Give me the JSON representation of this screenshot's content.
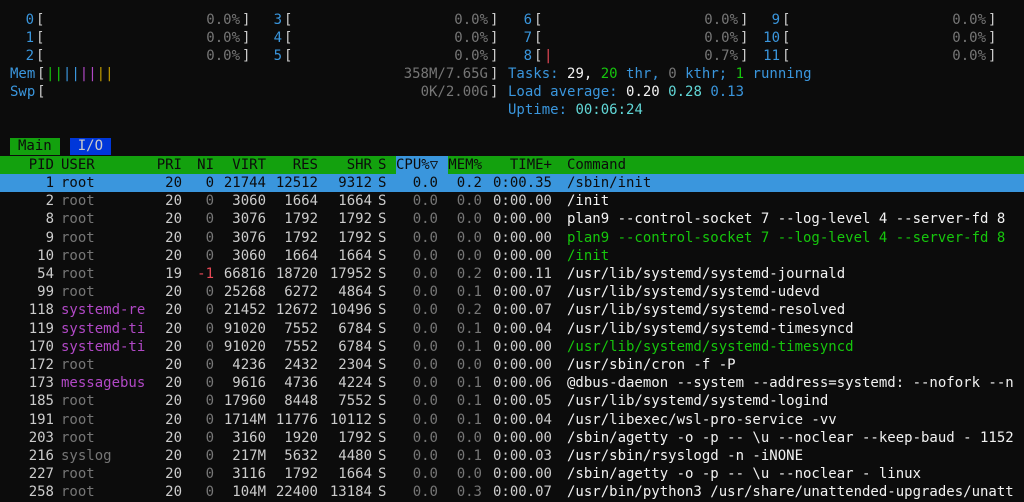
{
  "cpus": [
    {
      "id": "0",
      "bar": "",
      "value": "0.0%"
    },
    {
      "id": "1",
      "bar": "",
      "value": "0.0%"
    },
    {
      "id": "2",
      "bar": "",
      "value": "0.0%"
    },
    {
      "id": "3",
      "bar": "",
      "value": "0.0%"
    },
    {
      "id": "4",
      "bar": "",
      "value": "0.0%"
    },
    {
      "id": "5",
      "bar": "",
      "value": "0.0%"
    },
    {
      "id": "6",
      "bar": "",
      "value": "0.0%"
    },
    {
      "id": "7",
      "bar": "",
      "value": "0.0%"
    },
    {
      "id": "8",
      "bar": "|",
      "value": "0.7%"
    },
    {
      "id": "9",
      "bar": "",
      "value": "0.0%"
    },
    {
      "id": "10",
      "bar": "",
      "value": "0.0%"
    },
    {
      "id": "11",
      "bar": "",
      "value": "0.0%"
    }
  ],
  "mem": {
    "label": "Mem",
    "bars": "||||||||",
    "value": "358M/7.65G"
  },
  "swp": {
    "label": "Swp",
    "bars": "",
    "value": "0K/2.00G"
  },
  "tasks": {
    "label": "Tasks:",
    "count": "29,",
    "thr": "20",
    "thr_label": "thr,",
    "kthr": "0",
    "kthr_label": "kthr;",
    "running": "1",
    "running_label": "running"
  },
  "load": {
    "label": "Load average:",
    "v1": "0.20",
    "v5": "0.28",
    "v15": "0.13"
  },
  "uptime": {
    "label": "Uptime:",
    "value": "00:06:24"
  },
  "tabs": [
    "Main",
    "I/O"
  ],
  "columns": {
    "pid": "PID",
    "user": "USER",
    "pri": "PRI",
    "ni": "NI",
    "virt": "VIRT",
    "res": "RES",
    "shr": "SHR",
    "s": "S",
    "cpu": "CPU%▽",
    "mem": "MEM%",
    "time": "TIME+",
    "command": "Command"
  },
  "processes": [
    {
      "pid": "1",
      "user": "root",
      "pri": "20",
      "ni": "0",
      "virt": "21744",
      "res": "12512",
      "shr": "9312",
      "s": "S",
      "cpu": "0.0",
      "mem": "0.2",
      "time": "0:00.35",
      "command": "/sbin/init",
      "ucolor": "w",
      "ccolor": "w",
      "selected": true
    },
    {
      "pid": "2",
      "user": "root",
      "pri": "20",
      "ni": "0",
      "virt": "3060",
      "res": "1664",
      "shr": "1664",
      "s": "S",
      "cpu": "0.0",
      "mem": "0.0",
      "time": "0:00.00",
      "command": "/init",
      "ucolor": "gray",
      "ccolor": "w"
    },
    {
      "pid": "8",
      "user": "root",
      "pri": "20",
      "ni": "0",
      "virt": "3076",
      "res": "1792",
      "shr": "1792",
      "s": "S",
      "cpu": "0.0",
      "mem": "0.0",
      "time": "0:00.00",
      "command": "plan9 --control-socket 7 --log-level 4 --server-fd 8",
      "ucolor": "gray",
      "ccolor": "w"
    },
    {
      "pid": "9",
      "user": "root",
      "pri": "20",
      "ni": "0",
      "virt": "3076",
      "res": "1792",
      "shr": "1792",
      "s": "S",
      "cpu": "0.0",
      "mem": "0.0",
      "time": "0:00.00",
      "command": "plan9 --control-socket 7 --log-level 4 --server-fd 8",
      "ucolor": "gray",
      "ccolor": "g"
    },
    {
      "pid": "10",
      "user": "root",
      "pri": "20",
      "ni": "0",
      "virt": "3060",
      "res": "1664",
      "shr": "1664",
      "s": "S",
      "cpu": "0.0",
      "mem": "0.0",
      "time": "0:00.00",
      "command": "/init",
      "ucolor": "gray",
      "ccolor": "g"
    },
    {
      "pid": "54",
      "user": "root",
      "pri": "19",
      "ni": "-1",
      "virt": "66816",
      "res": "18720",
      "shr": "17952",
      "s": "S",
      "cpu": "0.0",
      "mem": "0.2",
      "time": "0:00.11",
      "command": "/usr/lib/systemd/systemd-journald",
      "ucolor": "gray",
      "ccolor": "w"
    },
    {
      "pid": "99",
      "user": "root",
      "pri": "20",
      "ni": "0",
      "virt": "25268",
      "res": "6272",
      "shr": "4864",
      "s": "S",
      "cpu": "0.0",
      "mem": "0.1",
      "time": "0:00.07",
      "command": "/usr/lib/systemd/systemd-udevd",
      "ucolor": "gray",
      "ccolor": "w"
    },
    {
      "pid": "118",
      "user": "systemd-re",
      "pri": "20",
      "ni": "0",
      "virt": "21452",
      "res": "12672",
      "shr": "10496",
      "s": "S",
      "cpu": "0.0",
      "mem": "0.2",
      "time": "0:00.07",
      "command": "/usr/lib/systemd/systemd-resolved",
      "ucolor": "mag",
      "ccolor": "w"
    },
    {
      "pid": "119",
      "user": "systemd-ti",
      "pri": "20",
      "ni": "0",
      "virt": "91020",
      "res": "7552",
      "shr": "6784",
      "s": "S",
      "cpu": "0.0",
      "mem": "0.1",
      "time": "0:00.04",
      "command": "/usr/lib/systemd/systemd-timesyncd",
      "ucolor": "mag",
      "ccolor": "w"
    },
    {
      "pid": "170",
      "user": "systemd-ti",
      "pri": "20",
      "ni": "0",
      "virt": "91020",
      "res": "7552",
      "shr": "6784",
      "s": "S",
      "cpu": "0.0",
      "mem": "0.1",
      "time": "0:00.00",
      "command": "/usr/lib/systemd/systemd-timesyncd",
      "ucolor": "mag",
      "ccolor": "g"
    },
    {
      "pid": "172",
      "user": "root",
      "pri": "20",
      "ni": "0",
      "virt": "4236",
      "res": "2432",
      "shr": "2304",
      "s": "S",
      "cpu": "0.0",
      "mem": "0.0",
      "time": "0:00.00",
      "command": "/usr/sbin/cron -f -P",
      "ucolor": "gray",
      "ccolor": "w"
    },
    {
      "pid": "173",
      "user": "messagebus",
      "pri": "20",
      "ni": "0",
      "virt": "9616",
      "res": "4736",
      "shr": "4224",
      "s": "S",
      "cpu": "0.0",
      "mem": "0.1",
      "time": "0:00.06",
      "command": "@dbus-daemon --system --address=systemd: --nofork --n",
      "ucolor": "mag",
      "ccolor": "w"
    },
    {
      "pid": "185",
      "user": "root",
      "pri": "20",
      "ni": "0",
      "virt": "17960",
      "res": "8448",
      "shr": "7552",
      "s": "S",
      "cpu": "0.0",
      "mem": "0.1",
      "time": "0:00.05",
      "command": "/usr/lib/systemd/systemd-logind",
      "ucolor": "gray",
      "ccolor": "w"
    },
    {
      "pid": "191",
      "user": "root",
      "pri": "20",
      "ni": "0",
      "virt": "1714M",
      "res": "11776",
      "shr": "10112",
      "s": "S",
      "cpu": "0.0",
      "mem": "0.1",
      "time": "0:00.04",
      "command": "/usr/libexec/wsl-pro-service -vv",
      "ucolor": "gray",
      "ccolor": "w"
    },
    {
      "pid": "203",
      "user": "root",
      "pri": "20",
      "ni": "0",
      "virt": "3160",
      "res": "1920",
      "shr": "1792",
      "s": "S",
      "cpu": "0.0",
      "mem": "0.0",
      "time": "0:00.00",
      "command": "/sbin/agetty -o -p -- \\u --noclear --keep-baud - 1152",
      "ucolor": "gray",
      "ccolor": "w"
    },
    {
      "pid": "216",
      "user": "syslog",
      "pri": "20",
      "ni": "0",
      "virt": "217M",
      "res": "5632",
      "shr": "4480",
      "s": "S",
      "cpu": "0.0",
      "mem": "0.1",
      "time": "0:00.03",
      "command": "/usr/sbin/rsyslogd -n -iNONE",
      "ucolor": "gray",
      "ccolor": "w"
    },
    {
      "pid": "227",
      "user": "root",
      "pri": "20",
      "ni": "0",
      "virt": "3116",
      "res": "1792",
      "shr": "1664",
      "s": "S",
      "cpu": "0.0",
      "mem": "0.0",
      "time": "0:00.00",
      "command": "/sbin/agetty -o -p -- \\u --noclear - linux",
      "ucolor": "gray",
      "ccolor": "w"
    },
    {
      "pid": "258",
      "user": "root",
      "pri": "20",
      "ni": "0",
      "virt": "104M",
      "res": "22400",
      "shr": "13184",
      "s": "S",
      "cpu": "0.0",
      "mem": "0.3",
      "time": "0:00.07",
      "command": "/usr/bin/python3 /usr/share/unattended-upgrades/unatt",
      "ucolor": "gray",
      "ccolor": "w"
    }
  ]
}
